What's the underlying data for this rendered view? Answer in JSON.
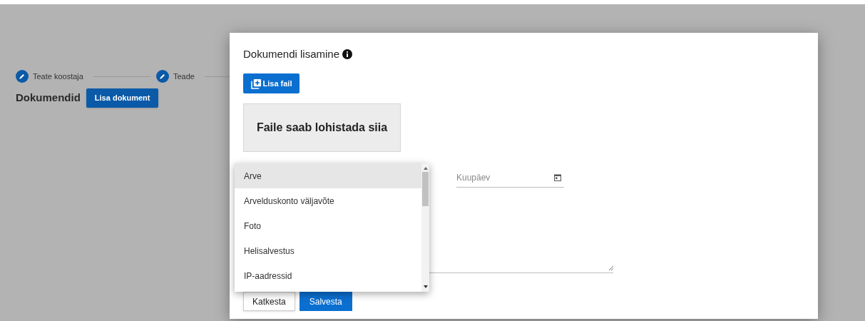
{
  "steps": [
    {
      "label": "Teate koostaja"
    },
    {
      "label": "Teade"
    }
  ],
  "documents": {
    "title": "Dokumendid",
    "add_button": "Lisa dokument"
  },
  "dialog": {
    "title": "Dokumendi lisamine",
    "add_file_button": "Lisa fail",
    "drop_zone": "Faile saab lohistada siia",
    "date_field": {
      "placeholder": "Kuupäev"
    },
    "buttons": [
      {
        "label": "Katkesta",
        "kind": "secondary"
      },
      {
        "label": "Salvesta",
        "kind": "primary"
      }
    ]
  },
  "dropdown": {
    "options": [
      {
        "label": "Arve",
        "selected": true
      },
      {
        "label": "Arvelduskonto väljavõte",
        "selected": false
      },
      {
        "label": "Foto",
        "selected": false
      },
      {
        "label": "Helisalvestus",
        "selected": false
      },
      {
        "label": "IP-aadressid",
        "selected": false
      }
    ]
  }
}
